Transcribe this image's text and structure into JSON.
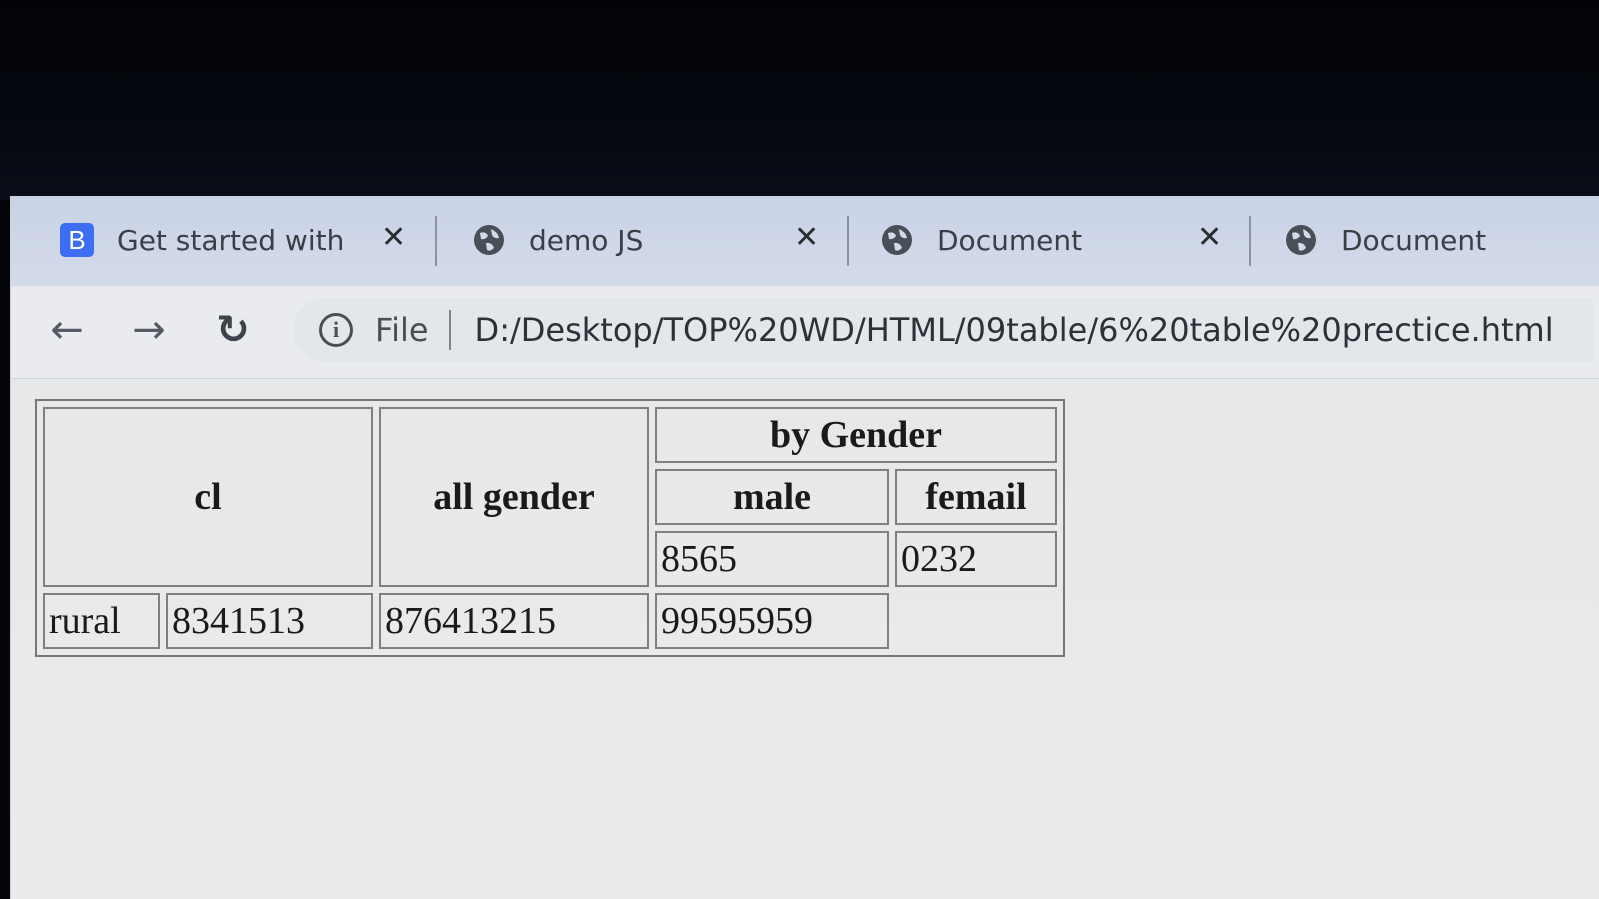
{
  "browser": {
    "tabs": [
      {
        "label": "Get started with B",
        "favicon": "bootstrap-icon",
        "closable": true
      },
      {
        "label": "demo JS",
        "favicon": "globe-icon",
        "closable": true
      },
      {
        "label": "Document",
        "favicon": "globe-icon",
        "closable": true
      },
      {
        "label": "Document",
        "favicon": "globe-icon",
        "closable": false
      }
    ],
    "close_glyph": "✕",
    "favicon_letter": "B",
    "nav": {
      "back": "←",
      "forward": "→",
      "reload": "↻"
    },
    "address": {
      "info_glyph": "i",
      "scheme_label": "File",
      "url": "D:/Desktop/TOP%20WD/HTML/09table/6%20table%20prectice.html"
    }
  },
  "table": {
    "header": {
      "col1": "cl",
      "col2": "all gender",
      "group": "by Gender",
      "male": "male",
      "female": "femail"
    },
    "header_values": {
      "male": "8565",
      "female": "0232"
    },
    "row": {
      "label": "rural",
      "cl_value": "8341513",
      "all_gender": "876413215",
      "male": "99595959"
    }
  }
}
